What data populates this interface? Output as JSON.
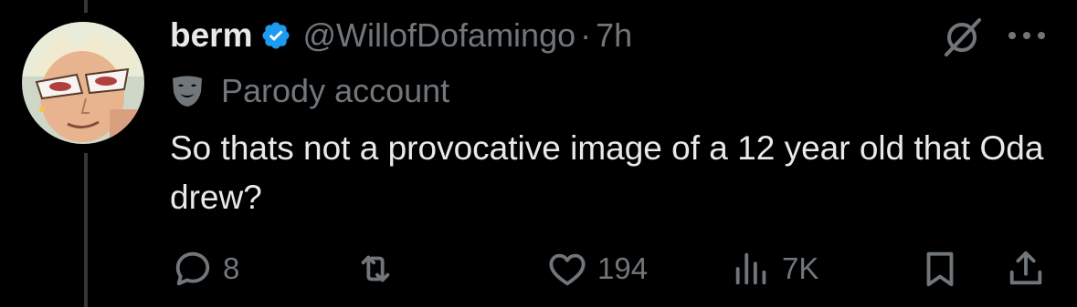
{
  "tweet": {
    "author": {
      "display_name": "berm",
      "handle": "@WillofDofamingo",
      "verified": true,
      "avatar_icon": "avatar-anime-character-with-sunglasses"
    },
    "separator": "·",
    "time": "7h",
    "label": {
      "icon": "mask-icon",
      "text": "Parody account"
    },
    "text": "So thats not a provocative image of a 12 year old that Oda drew?",
    "actions": {
      "reply_count": "8",
      "repost_count": "",
      "like_count": "194",
      "views_count": "7K"
    }
  },
  "icons": [
    "verified-badge-icon",
    "grok-icon",
    "more-icon",
    "mask-icon",
    "reply-icon",
    "repost-icon",
    "like-icon",
    "views-icon",
    "bookmark-icon",
    "share-icon"
  ],
  "colors": {
    "background": "#000000",
    "primary_text": "#e7e9ea",
    "secondary_text": "#71767b",
    "verified_blue": "#1d9bf0",
    "thread_line": "#333639"
  }
}
